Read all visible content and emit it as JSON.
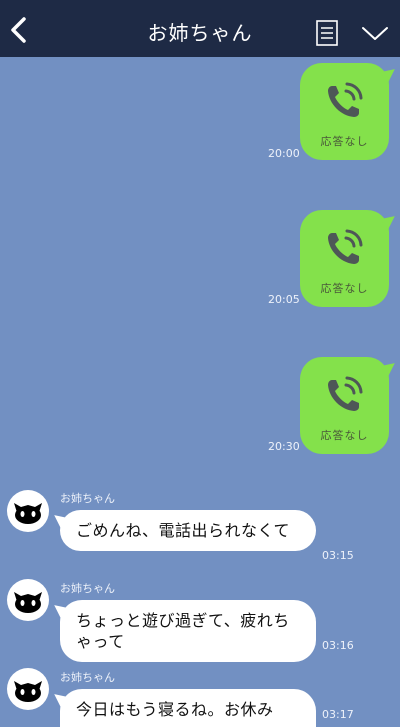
{
  "header": {
    "title": "お姉ちゃん",
    "back_icon": "chevron-left-icon",
    "notes_icon": "notes-icon",
    "menu_icon": "chevron-down-icon"
  },
  "colors": {
    "header_bg": "#1e2a45",
    "chat_bg": "#7290c2",
    "sent_bubble": "#84e14b",
    "received_bubble": "#ffffff"
  },
  "calls": [
    {
      "label": "応答なし",
      "time": "20:00"
    },
    {
      "label": "応答なし",
      "time": "20:05"
    },
    {
      "label": "応答なし",
      "time": "20:30"
    }
  ],
  "messages": [
    {
      "sender": "お姉ちゃん",
      "text": "ごめんね、電話出られなくて",
      "time": "03:15"
    },
    {
      "sender": "お姉ちゃん",
      "text": "ちょっと遊び過ぎて、疲れちゃって",
      "time": "03:16"
    },
    {
      "sender": "お姉ちゃん",
      "text": "今日はもう寝るね。お休み",
      "time": "03:17"
    }
  ]
}
